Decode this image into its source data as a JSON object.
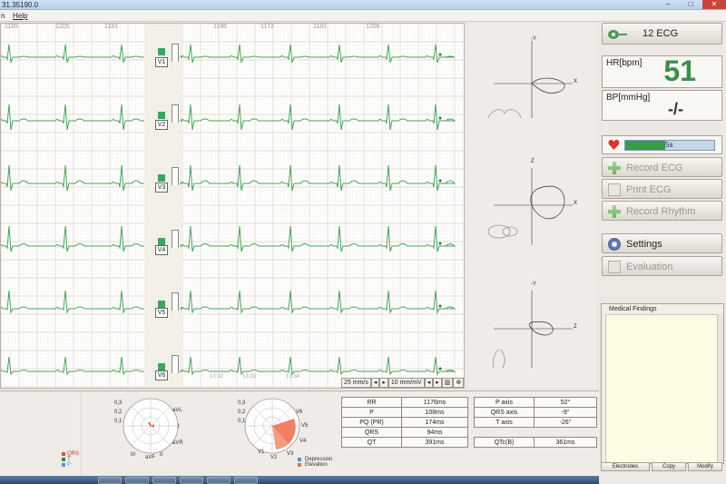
{
  "window": {
    "title": "31.35190.0",
    "close_glyph": "✕",
    "min_glyph": "–",
    "max_glyph": "□"
  },
  "menu": {
    "items": [
      "n",
      "Help"
    ]
  },
  "leads": {
    "left_labels": [
      "1185",
      "1205",
      "1181"
    ],
    "right_labels": [
      "1186",
      "1172",
      "1181",
      "1206"
    ],
    "items": [
      "V1",
      "V2",
      "V3",
      "V4",
      "V5",
      "V6"
    ],
    "time_marks": [
      "13:32",
      "13:33",
      "13:34"
    ]
  },
  "speed": {
    "paper": "25 mm/s",
    "gain": "10 mm/mV"
  },
  "vcg": {
    "frontal": {
      "top": "-Y",
      "right": "X"
    },
    "horizontal": {
      "top": "Z",
      "right": "X"
    },
    "sagittal": {
      "top": "-Y",
      "right": "Z"
    }
  },
  "right": {
    "ecg_button": "12 ECG",
    "hr_label": "HR[bpm]",
    "hr_value": "51",
    "bp_label": "BP[mmHg]",
    "bp_value": "-/-",
    "timer_label": "5s",
    "timer_progress": 0.45,
    "record_ecg": "Record ECG",
    "print_ecg": "Print ECG",
    "record_rhythm": "Record Rhythm",
    "settings": "Settings",
    "evaluation": "Evaluation"
  },
  "findings": {
    "title": "Medical Findings",
    "electrodes": "Electrodes",
    "copy": "Copy",
    "modify": "Modify"
  },
  "polar1": {
    "scale": [
      "0,3",
      "0,2",
      "0,1"
    ],
    "labels": {
      "avl": "aVL",
      "i": "I",
      "avr": "aVR",
      "avf": "aVF",
      "ii": "II",
      "iii": "III"
    },
    "legend": [
      "QRS",
      "T",
      "P"
    ]
  },
  "polar2": {
    "scale": [
      "0,3",
      "0,2",
      "0,1"
    ],
    "labels": {
      "v1": "V1",
      "v2": "V2",
      "v3": "V3",
      "v4": "V4",
      "v5": "V5",
      "v6": "V6"
    },
    "legend": [
      "Depression",
      "Elevation"
    ]
  },
  "measurements": {
    "left": [
      [
        "RR",
        "1176ms"
      ],
      [
        "P",
        "108ms"
      ],
      [
        "PQ (PR)",
        "174ms"
      ],
      [
        "QRS",
        "94ms"
      ],
      [
        "QT",
        "391ms"
      ]
    ],
    "right": [
      [
        "P axis",
        "52°"
      ],
      [
        "QRS axis",
        "-9°"
      ],
      [
        "T axis",
        "-26°"
      ],
      [
        "",
        ""
      ],
      [
        "QTc(B)",
        "361ms"
      ]
    ]
  },
  "colors": {
    "trace": "#4aa35a",
    "grid_major": "#d8d2c6",
    "grid_minor": "#efebe3",
    "accent_green": "#3e8e4a",
    "elevation": "#ef6a4a",
    "depression": "#5c8fd0"
  }
}
